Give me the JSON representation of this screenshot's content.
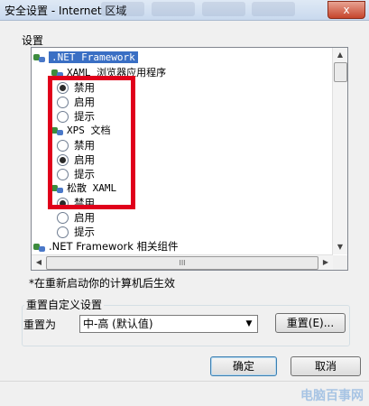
{
  "window": {
    "title": "安全设置 - Internet 区域",
    "close_label": "x"
  },
  "settings_label": "设置",
  "tree": {
    "items": [
      {
        "kind": "group",
        "label": ".NET Framework",
        "selected": true
      },
      {
        "kind": "group",
        "label": "XAML 浏览器应用程序"
      },
      {
        "kind": "radio",
        "label": "禁用",
        "checked": true
      },
      {
        "kind": "radio",
        "label": "启用",
        "checked": false
      },
      {
        "kind": "radio",
        "label": "提示",
        "checked": false
      },
      {
        "kind": "group",
        "label": "XPS 文档"
      },
      {
        "kind": "radio",
        "label": "禁用",
        "checked": false
      },
      {
        "kind": "radio",
        "label": "启用",
        "checked": true
      },
      {
        "kind": "radio",
        "label": "提示",
        "checked": false
      },
      {
        "kind": "group",
        "label": "松散 XAML"
      },
      {
        "kind": "radio",
        "label": "禁用",
        "checked": true
      },
      {
        "kind": "radio",
        "label": "启用",
        "checked": false
      },
      {
        "kind": "radio",
        "label": "提示",
        "checked": false
      },
      {
        "kind": "group",
        "label": ".NET Framework 相关组件"
      }
    ],
    "hscroll_grip": "III"
  },
  "restart_note": "*在重新启动你的计算机后生效",
  "reset": {
    "group_title": "重置自定义设置",
    "reset_to_label": "重置为",
    "level_value": "中-高 (默认值)",
    "reset_button": "重置(E)..."
  },
  "footer": {
    "ok_button": "确定",
    "cancel_button": "取消"
  },
  "watermark": "电脑百事网",
  "colors": {
    "highlight_box": "#e0001b",
    "selection": "#3a6fc4"
  }
}
